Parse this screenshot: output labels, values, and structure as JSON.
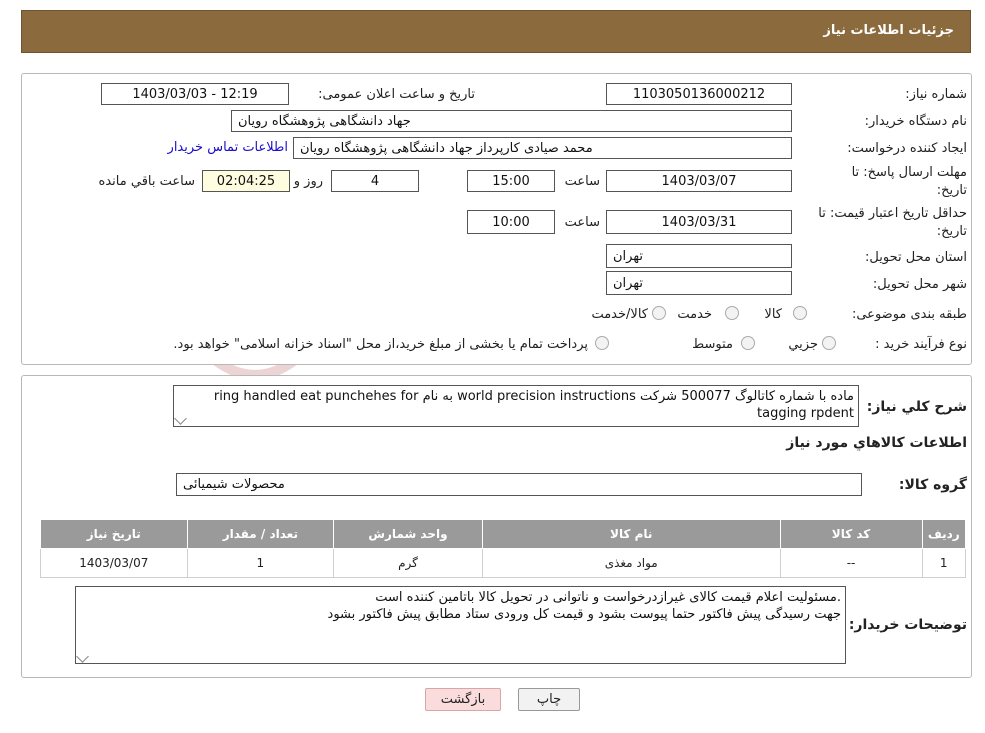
{
  "header": {
    "title": "جزئیات اطلاعات نیاز"
  },
  "form": {
    "need_number_label": "شماره نیاز:",
    "need_number": "1103050136000212",
    "announce_label": "تاریخ و ساعت اعلان عمومی:",
    "announce_value": "1403/03/03 - 12:19",
    "buyer_label": "نام دستگاه خریدار:",
    "buyer_value": "جهاد دانشگاهی پژوهشگاه رویان",
    "creator_label": "ایجاد کننده درخواست:",
    "creator_value": "محمد صیادی کارپرداز جهاد دانشگاهی پژوهشگاه رویان",
    "contact_link": "اطلاعات تماس خریدار",
    "deadline_label_1": "مهلت ارسال پاسخ: تا",
    "deadline_label_2": "تاریخ:",
    "deadline_date": "1403/03/07",
    "time_label": "ساعت",
    "deadline_time": "15:00",
    "days_value": "4",
    "days_label": "روز و",
    "remaining_time": "02:04:25",
    "remaining_label": "ساعت باقي مانده",
    "validity_label_1": "حداقل تاریخ اعتبار قیمت: تا",
    "validity_label_2": "تاریخ:",
    "validity_date": "1403/03/31",
    "validity_time": "10:00",
    "province_label": "استان محل تحویل:",
    "province_value": "تهران",
    "city_label": "شهر محل تحویل:",
    "city_value": "تهران",
    "category_label": "طبقه بندی موضوعی:",
    "category_options": [
      "کالا",
      "خدمت",
      "کالا/خدمت"
    ],
    "process_label": "نوع فرآیند خرید :",
    "process_options": [
      "جزیي",
      "متوسط"
    ],
    "process_note": "پرداخت تمام یا بخشی از مبلغ خرید،از محل \"اسناد خزانه اسلامی\" خواهد بود."
  },
  "description": {
    "label": "شرح کلي نياز:",
    "text": "ماده با شماره کاتالوگ  500077 شرکت world precision instructions به نام ring handled eat punchehes for tagging rpdent"
  },
  "goods": {
    "section_title": "اطلاعات کالاهاي مورد نياز",
    "group_label": "گروه کالا:",
    "group_value": "محصولات شیمیائی",
    "columns": [
      "رديف",
      "کد کالا",
      "نام کالا",
      "واحد شمارش",
      "تعداد / مقدار",
      "تاریخ نیاز"
    ],
    "rows": [
      [
        "1",
        "--",
        "مواد مغذی",
        "گرم",
        "1",
        "1403/03/07"
      ]
    ]
  },
  "notes": {
    "label": "توضیحات خریدار:",
    "line1": ".مسئولیت اعلام قیمت کالای غیرازدرخواست و ناتوانی در تحویل کالا باتامین کننده است",
    "line2": "جهت رسیدگی پیش فاکتور حتما پیوست بشود و قیمت کل ورودی ستاد مطابق پیش فاکتور بشود"
  },
  "buttons": {
    "print": "چاپ",
    "back": "بازگشت"
  },
  "colors": {
    "header": "#8b6a3e",
    "link": "#1a0dcc",
    "back_button": "#fbdcdc",
    "print_button": "#f2f2f2"
  }
}
